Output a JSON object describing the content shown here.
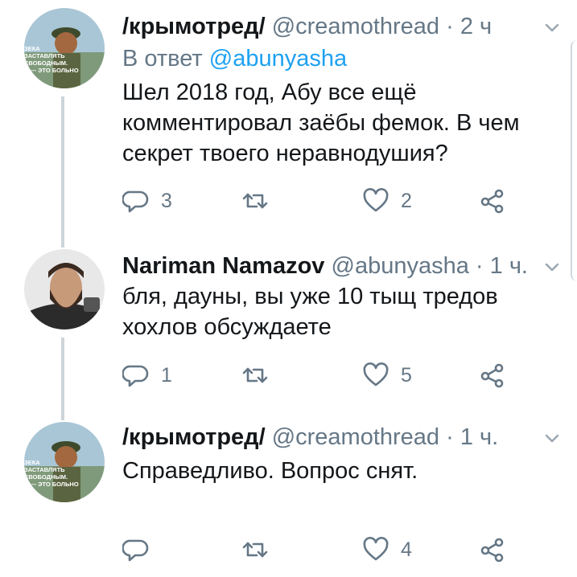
{
  "tweets": [
    {
      "name": "/крымотред/",
      "handle": "@creamothread",
      "sep": "·",
      "time": "2 ч",
      "reply_prefix": "В ответ",
      "reply_handle": "@abunyasha",
      "text": "Шел 2018 год, Абу все ещё\nкомментировал заёбы фемок. В чем\nсекрет твоего неравнодушия?",
      "replies": "3",
      "retweets": "",
      "likes": "2",
      "avatar_caption": [
        "ЗЕКА",
        "ЗАСТАВЛЯТЬ",
        "СВОБОДНЫМ.",
        "А — ЭТО БОЛЬНО"
      ]
    },
    {
      "name": "Nariman Namazov",
      "handle": "@abunyasha",
      "sep": "·",
      "time": "1 ч.",
      "text": "бля, дауны, вы уже 10 тыщ тредов\nхохлов обсуждаете",
      "replies": "1",
      "retweets": "",
      "likes": "5"
    },
    {
      "name": "/крымотред/",
      "handle": "@creamothread",
      "sep": "·",
      "time": "1 ч.",
      "text": "Справедливо. Вопрос снят.",
      "replies": "",
      "retweets": "",
      "likes": "4",
      "avatar_caption": [
        "ЗЕКА",
        "ЗАСТАВЛЯТЬ",
        "СВОБОДНЫМ.",
        "А — ЭТО БОЛЬНО"
      ]
    }
  ],
  "colors": {
    "text": "#14171a",
    "muted": "#657786",
    "link": "#1da1f2",
    "thread_line": "#cdd4da"
  },
  "icons": [
    "reply-icon",
    "retweet-icon",
    "like-icon",
    "share-icon",
    "chevron-down-icon"
  ]
}
